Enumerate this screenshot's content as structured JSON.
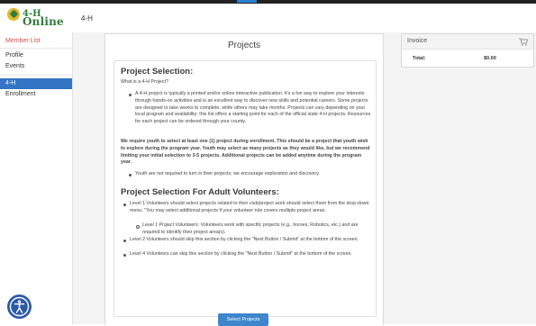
{
  "app": {
    "logo_line1": "4-H",
    "logo_line2": "Online",
    "header_title": "4-H"
  },
  "sidebar": {
    "member_list": "Member List",
    "profile": "Profile",
    "events": "Events",
    "active": "4-H",
    "enrollment": "Enrollment"
  },
  "main": {
    "title": "Projects",
    "section1_heading": "Project Selection:",
    "question": "What is a 4-H Project?",
    "bullet1": "A 4-H project is typically a printed and/or online interactive publication. It's a fun way to explore your interests through hands-on activities and is an excellent way to discover new skills and potential careers. Some projects are designed to take weeks to complete, while others may take months. Projects can vary depending on your local program and availability; this list offers a starting point for each of the official state 4-H projects. Resources for each project can be ordered through your county.",
    "requirement": "We require youth to select at least one (1) project during enrollment. This should be a project that youth wish to explore during the program year. Youth may select as many projects as they would like, but we recommend limiting your initial selection to 3-5 projects. Additional projects can be added anytime during the program year.",
    "bullet2_pre": "Youth are ",
    "bullet2_italic": "not required",
    "bullet2_post": " to turn in their projects; we encourage exploration and discovery.",
    "section2_heading": "Project Selection For Adult Volunteers:",
    "adult1": "Level 1 Volunteers should select projects related to their club/project work should select them from the drop-down menu. \"You may select additional projects if your volunteer role covers multiple project areas.",
    "adult1_sub_italic": "Level 1 Project Volunteers:",
    "adult1_sub_rest": " Volunteers work with specific projects (e.g., horses, Robotics, etc.) and are required to identify their project area(s).",
    "adult2": "Level 2 Volunteers should skip this section by clicking the \"Next Button / Submit\" at the bottom of the screen.",
    "adult3": "Level 4 Volunteers can skip this section by clicking the \"Next Button / Submit\" at the bottom of the screen.",
    "select_button": "Select Projects"
  },
  "invoice": {
    "title": "Invoice",
    "total_label": "Total:",
    "total_amount": "$0.00",
    "cart_icon": "cart-icon"
  },
  "accessibility": {
    "icon": "accessibility-icon"
  },
  "colors": {
    "brand_green": "#2f7d3a",
    "accent_blue": "#3374c5",
    "member_red": "#d14d46"
  }
}
